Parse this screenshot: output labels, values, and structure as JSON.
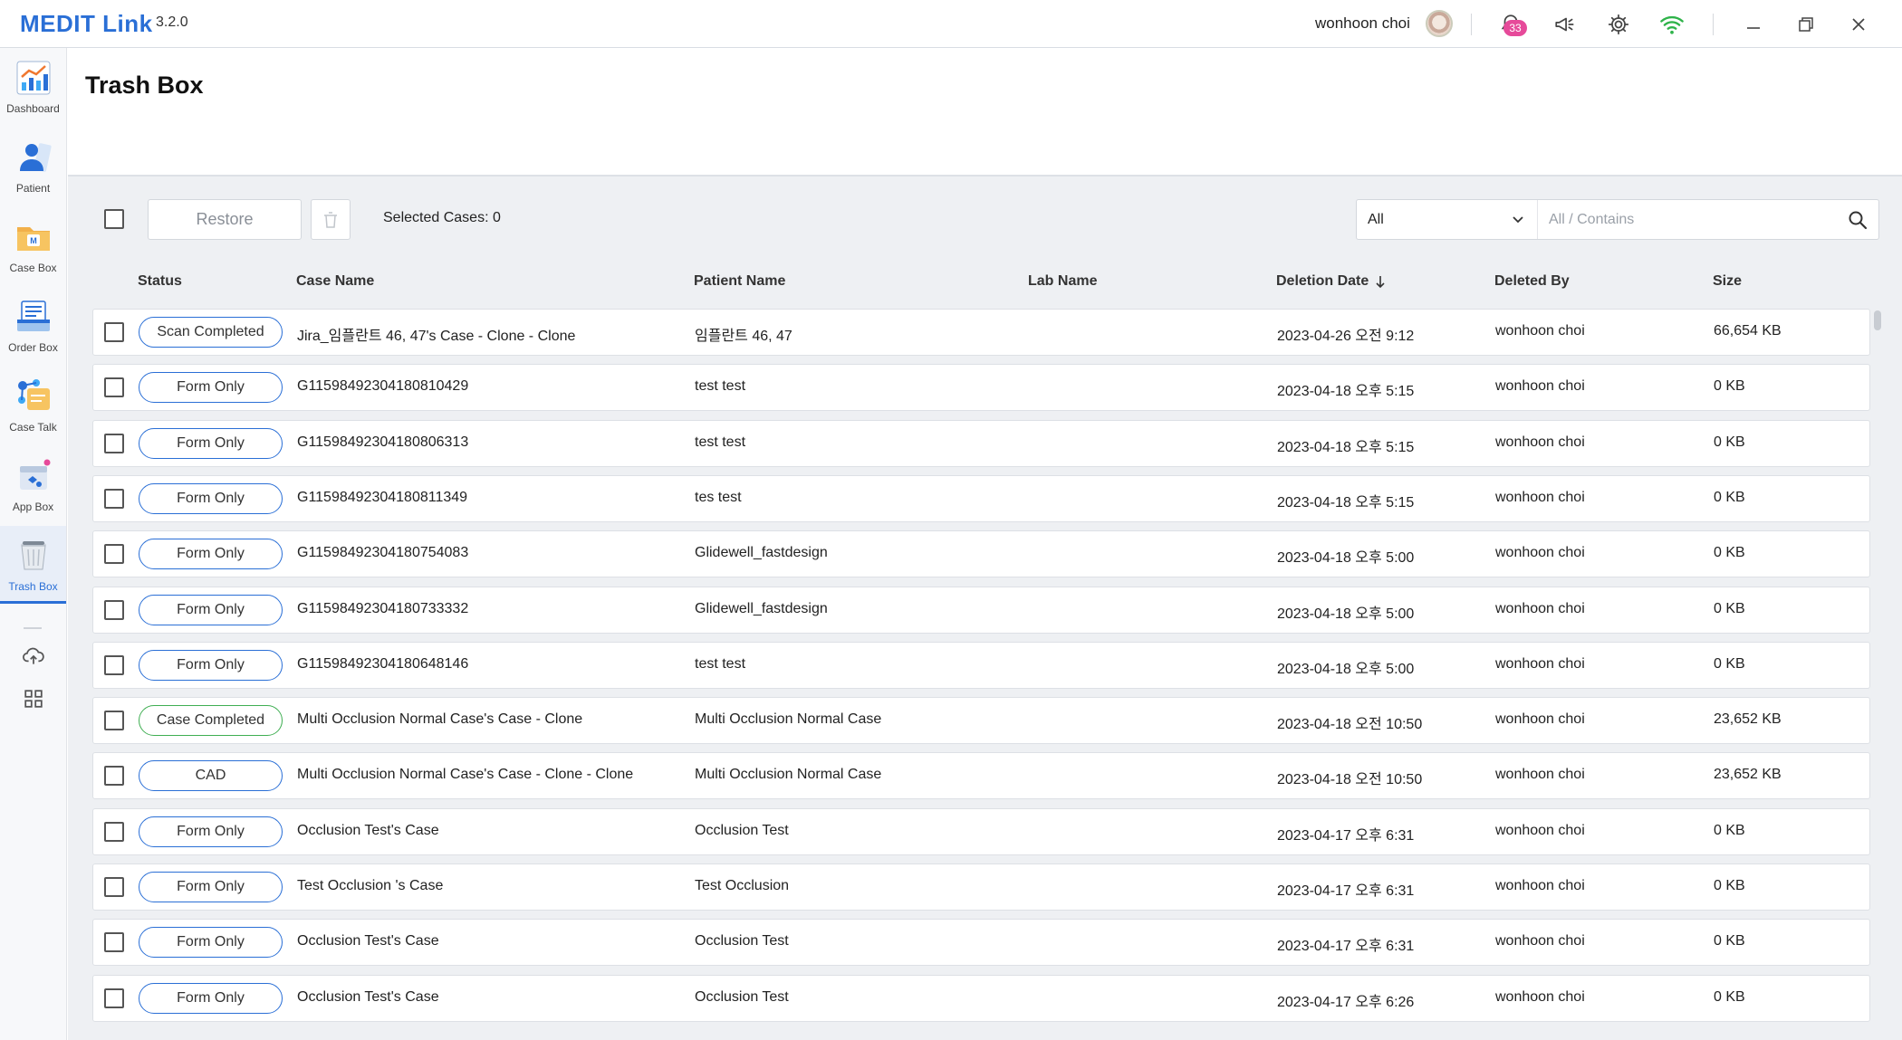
{
  "app": {
    "name": "MEDIT Link",
    "version": "3.2.0",
    "user_name": "wonhoon choi",
    "notification_count": "33",
    "accent_color": "#2a6fd6"
  },
  "sidebar": {
    "items": [
      {
        "label": "Dashboard",
        "icon": "dashboard-chart-icon"
      },
      {
        "label": "Patient",
        "icon": "patient-person-icon"
      },
      {
        "label": "Case Box",
        "icon": "case-box-folder-icon"
      },
      {
        "label": "Order Box",
        "icon": "order-box-icon"
      },
      {
        "label": "Case Talk",
        "icon": "case-talk-share-icon"
      },
      {
        "label": "App Box",
        "icon": "app-box-icon"
      },
      {
        "label": "Trash Box",
        "icon": "trash-box-icon",
        "active": true
      }
    ],
    "tools": [
      "cloud-upload-icon",
      "grid-apps-icon"
    ]
  },
  "page": {
    "title": "Trash Box"
  },
  "toolbar": {
    "restore_label": "Restore",
    "selected_cases": "Selected Cases: 0",
    "filter_value": "All",
    "search_placeholder": "All / Contains"
  },
  "table": {
    "headers": {
      "status": "Status",
      "case_name": "Case Name",
      "patient_name": "Patient Name",
      "lab_name": "Lab Name",
      "deletion_date": "Deletion Date",
      "deleted_by": "Deleted By",
      "size": "Size"
    },
    "rows": [
      {
        "status": "Scan Completed",
        "status_color": "#2a6fd6",
        "case_name": "Jira_임플란트 46, 47's Case - Clone - Clone",
        "patient_name": "임플란트 46, 47",
        "lab_name": "",
        "deletion_date": "2023-04-26 오전 9:12",
        "deleted_by": "wonhoon choi",
        "size": "66,654 KB"
      },
      {
        "status": "Form Only",
        "status_color": "#2a6fd6",
        "case_name": "G11598492304180810429",
        "patient_name": "test test",
        "lab_name": "",
        "deletion_date": "2023-04-18 오후 5:15",
        "deleted_by": "wonhoon choi",
        "size": "0 KB"
      },
      {
        "status": "Form Only",
        "status_color": "#2a6fd6",
        "case_name": "G11598492304180806313",
        "patient_name": "test test",
        "lab_name": "",
        "deletion_date": "2023-04-18 오후 5:15",
        "deleted_by": "wonhoon choi",
        "size": "0 KB"
      },
      {
        "status": "Form Only",
        "status_color": "#2a6fd6",
        "case_name": "G11598492304180811349",
        "patient_name": "tes test",
        "lab_name": "",
        "deletion_date": "2023-04-18 오후 5:15",
        "deleted_by": "wonhoon choi",
        "size": "0 KB"
      },
      {
        "status": "Form Only",
        "status_color": "#2a6fd6",
        "case_name": "G11598492304180754083",
        "patient_name": "Glidewell_fastdesign",
        "lab_name": "",
        "deletion_date": "2023-04-18 오후 5:00",
        "deleted_by": "wonhoon choi",
        "size": "0 KB"
      },
      {
        "status": "Form Only",
        "status_color": "#2a6fd6",
        "case_name": "G11598492304180733332",
        "patient_name": "Glidewell_fastdesign",
        "lab_name": "",
        "deletion_date": "2023-04-18 오후 5:00",
        "deleted_by": "wonhoon choi",
        "size": "0 KB"
      },
      {
        "status": "Form Only",
        "status_color": "#2a6fd6",
        "case_name": "G11598492304180648146",
        "patient_name": "test test",
        "lab_name": "",
        "deletion_date": "2023-04-18 오후 5:00",
        "deleted_by": "wonhoon choi",
        "size": "0 KB"
      },
      {
        "status": "Case Completed",
        "status_color": "#3fae52",
        "case_name": "Multi Occlusion Normal Case's Case - Clone",
        "patient_name": "Multi Occlusion Normal Case",
        "lab_name": "",
        "deletion_date": "2023-04-18 오전 10:50",
        "deleted_by": "wonhoon choi",
        "size": "23,652 KB"
      },
      {
        "status": "CAD",
        "status_color": "#2a6fd6",
        "case_name": "Multi Occlusion Normal Case's Case - Clone - Clone",
        "patient_name": "Multi Occlusion Normal Case",
        "lab_name": "",
        "deletion_date": "2023-04-18 오전 10:50",
        "deleted_by": "wonhoon choi",
        "size": "23,652 KB"
      },
      {
        "status": "Form Only",
        "status_color": "#2a6fd6",
        "case_name": "Occlusion Test's Case",
        "patient_name": "Occlusion Test",
        "lab_name": "",
        "deletion_date": "2023-04-17 오후 6:31",
        "deleted_by": "wonhoon choi",
        "size": "0 KB"
      },
      {
        "status": "Form Only",
        "status_color": "#2a6fd6",
        "case_name": "Test Occlusion 's Case",
        "patient_name": "Test Occlusion",
        "lab_name": "",
        "deletion_date": "2023-04-17 오후 6:31",
        "deleted_by": "wonhoon choi",
        "size": "0 KB"
      },
      {
        "status": "Form Only",
        "status_color": "#2a6fd6",
        "case_name": "Occlusion Test's Case",
        "patient_name": "Occlusion Test",
        "lab_name": "",
        "deletion_date": "2023-04-17 오후 6:31",
        "deleted_by": "wonhoon choi",
        "size": "0 KB"
      },
      {
        "status": "Form Only",
        "status_color": "#2a6fd6",
        "case_name": "Occlusion Test's Case",
        "patient_name": "Occlusion Test",
        "lab_name": "",
        "deletion_date": "2023-04-17 오후 6:26",
        "deleted_by": "wonhoon choi",
        "size": "0 KB"
      }
    ]
  }
}
